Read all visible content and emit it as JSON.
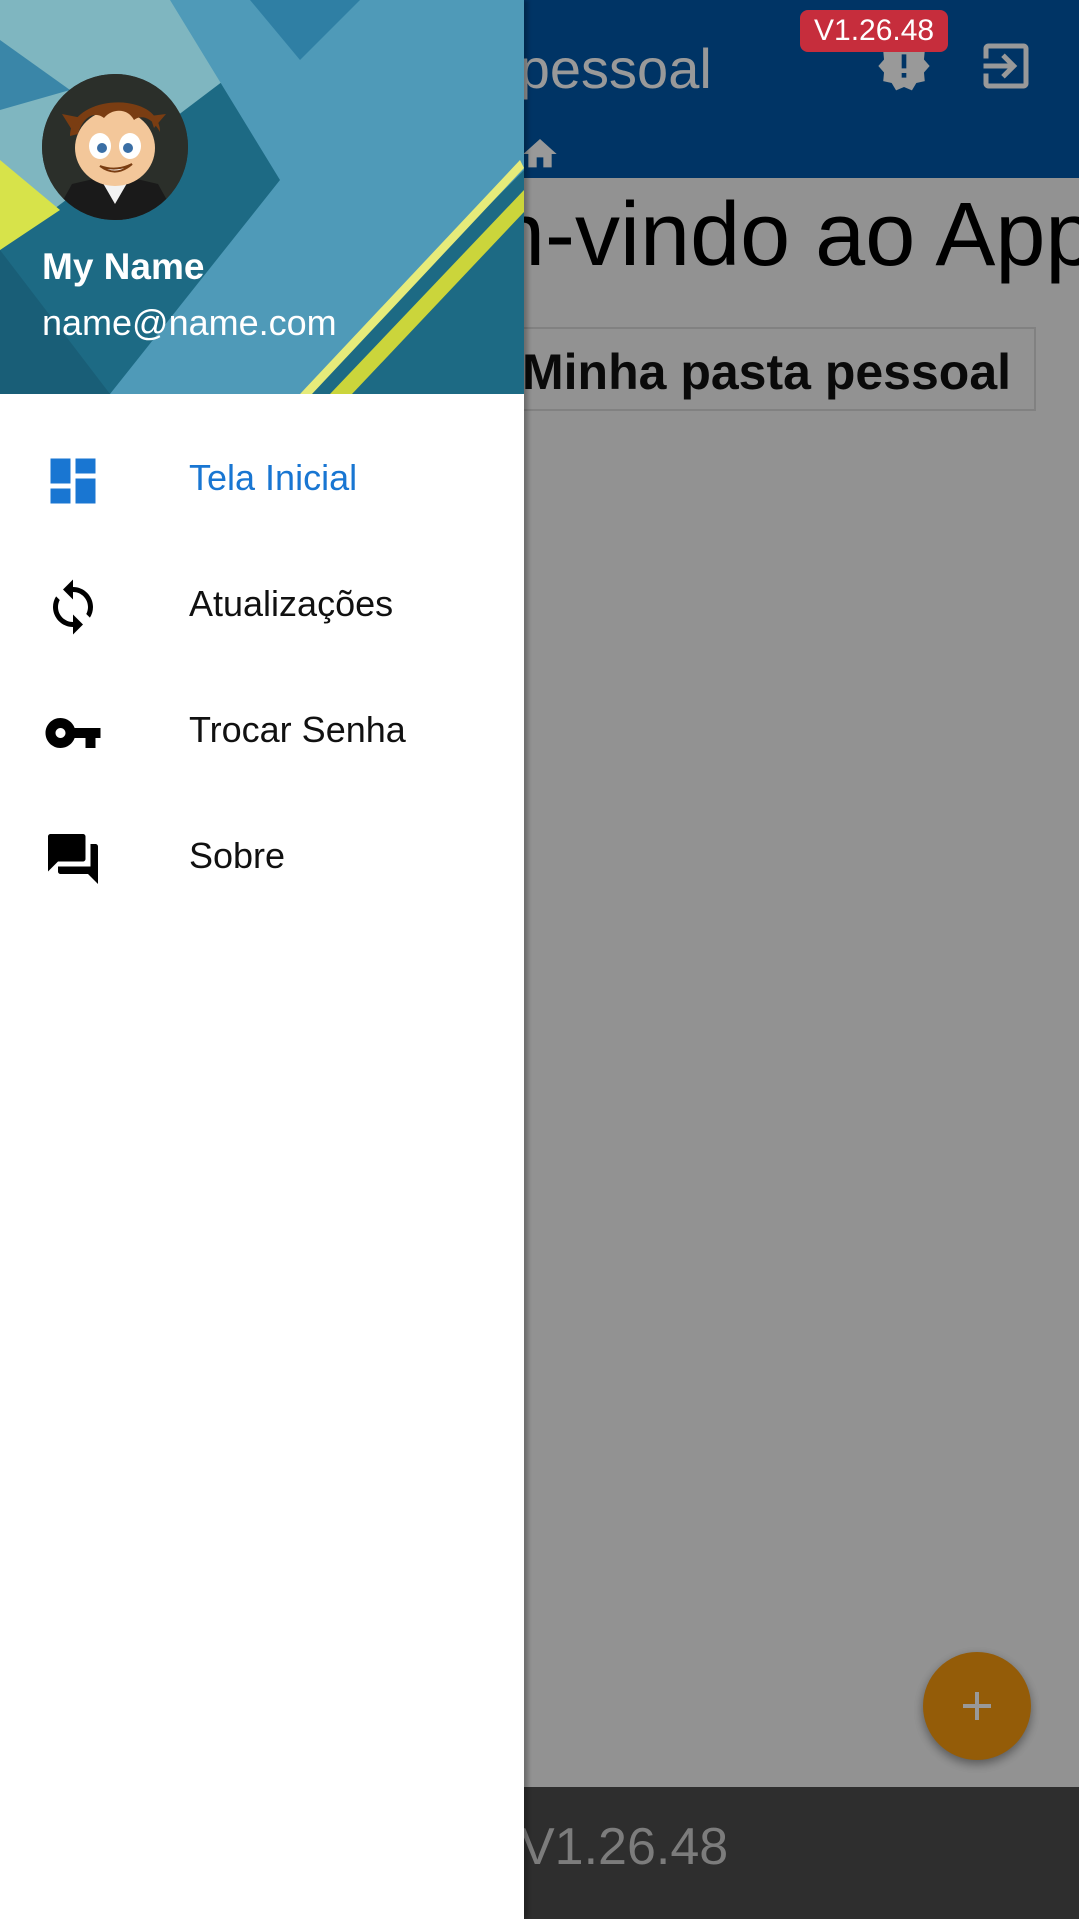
{
  "app": {
    "title": "Pasta pessoal",
    "version_badge": "V1.26.48",
    "welcome": "Bem-vindo ao App",
    "folder_card_label": "Minha pasta pessoal",
    "footer_version": "V1.26.48",
    "colors": {
      "appbar": "#0058a8",
      "badge": "#c62d3c",
      "fab": "#f79a0e",
      "bottom_bar": "#4d4d4d"
    },
    "icons": {
      "alert": "alert-badge-icon",
      "logout": "logout-icon",
      "home": "home-icon",
      "fab": "plus-icon"
    }
  },
  "drawer": {
    "user": {
      "name": "My Name",
      "email": "name@name.com"
    },
    "accent_color": "#1976d2",
    "items": [
      {
        "label": "Tela Inicial",
        "icon": "dashboard-icon",
        "active": true
      },
      {
        "label": "Atualizações",
        "icon": "sync-icon",
        "active": false
      },
      {
        "label": "Trocar Senha",
        "icon": "key-icon",
        "active": false
      },
      {
        "label": "Sobre",
        "icon": "forum-icon",
        "active": false
      }
    ]
  }
}
